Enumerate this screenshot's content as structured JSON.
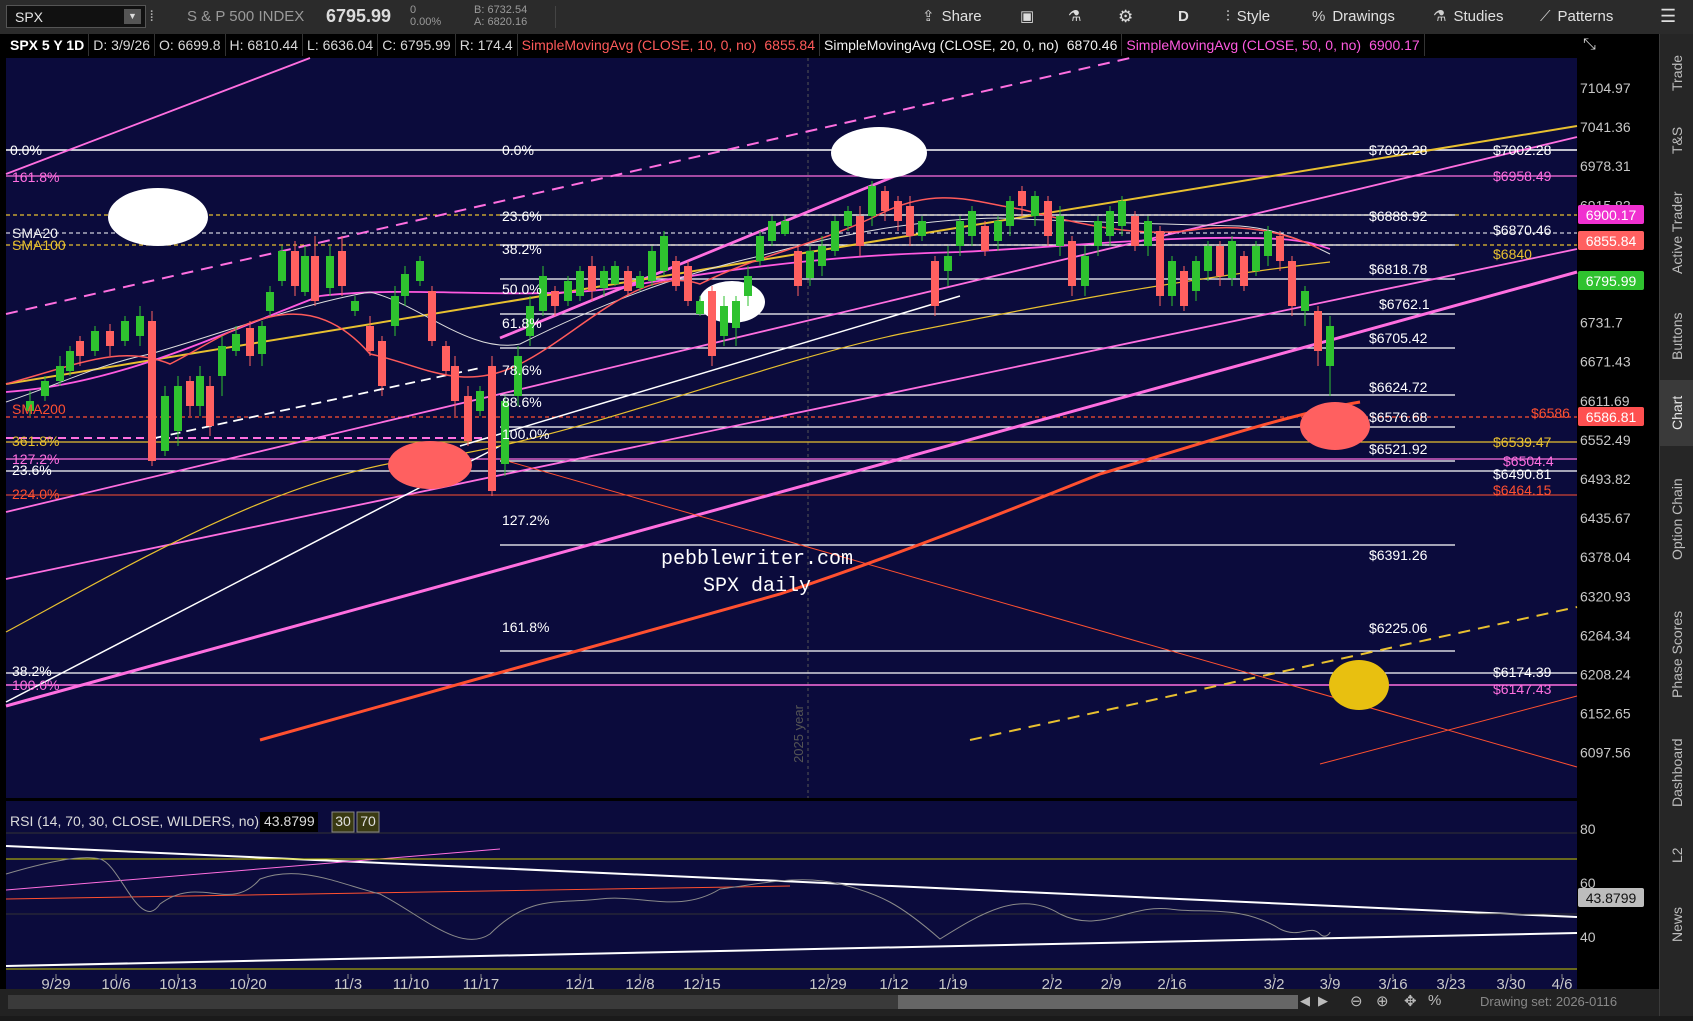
{
  "toolbar": {
    "symbol": "SPX",
    "name": "S & P 500 INDEX",
    "last": "6795.99",
    "change": "0",
    "change_pct": "0.00%",
    "bid": "B: 6732.54",
    "ask": "A: 6820.16",
    "share": "Share",
    "aggregation": "D",
    "style": "Style",
    "drawings": "Drawings",
    "studies": "Studies",
    "patterns": "Patterns"
  },
  "header": {
    "series": "SPX 5 Y 1D",
    "date": "D: 3/9/26",
    "open": "O: 6699.8",
    "high": "H: 6810.44",
    "low": "L: 6636.04",
    "close": "C: 6795.99",
    "range": "R: 174.4",
    "sma10_label": "SimpleMovingAvg (CLOSE, 10, 0, no)",
    "sma10_value": "6855.84",
    "sma20_label": "SimpleMovingAvg (CLOSE, 20, 0, no)",
    "sma20_value": "6870.46",
    "sma50_label": "SimpleMovingAvg (CLOSE, 50, 0, no)",
    "sma50_value": "6900.17"
  },
  "price_axis": [
    "7104.97",
    "7041.36",
    "6978.31",
    "6915.82",
    "6853.41",
    "6792.54",
    "6731.7",
    "6671.43",
    "6611.69",
    "6552.49",
    "6493.82",
    "6435.67",
    "6378.04",
    "6320.93",
    "6264.34",
    "6208.24",
    "6152.65",
    "6097.56"
  ],
  "price_badges": [
    {
      "text": "6900.17",
      "bg": "#f030d0",
      "fg": "#ffffff"
    },
    {
      "text": "6855.84",
      "bg": "#ff6060",
      "fg": "#ffffff"
    },
    {
      "text": "6795.99",
      "bg": "#2fc22f",
      "fg": "#ffffff"
    },
    {
      "text": "6586.81",
      "bg": "#ff5050",
      "fg": "#ffffff"
    },
    {
      "text": "43.8799",
      "bg": "#bdbdbd",
      "fg": "#111111"
    }
  ],
  "x_axis": [
    "9/29",
    "10/6",
    "10/13",
    "10/20",
    "11/3",
    "11/10",
    "11/17",
    "12/1",
    "12/8",
    "12/15",
    "12/29",
    "1/12",
    "1/19",
    "2/2",
    "2/9",
    "2/16",
    "3/2",
    "3/9",
    "3/16",
    "3/23",
    "3/30",
    "4/6"
  ],
  "year_marker": "2025 year",
  "left_fib": [
    {
      "text": "0.0%",
      "color": "#ffffff"
    },
    {
      "text": "161.8%",
      "color": "#ff6fe0"
    },
    {
      "text": "SMA20",
      "color": "#f0f0f0"
    },
    {
      "text": "SMA100",
      "color": "#e8c030"
    },
    {
      "text": "SMA200",
      "color": "#ff5030"
    },
    {
      "text": "361.8%",
      "color": "#e8c030"
    },
    {
      "text": "127.2%",
      "color": "#ff6fe0"
    },
    {
      "text": "23.6%",
      "color": "#ffffff"
    },
    {
      "text": "224.0%",
      "color": "#ff5030"
    },
    {
      "text": "38.2%",
      "color": "#ffffff"
    },
    {
      "text": "100.0%",
      "color": "#ff6fe0"
    }
  ],
  "mid_fib": [
    "0.0%",
    "23.6%",
    "38.2%",
    "50.0%",
    "61.8%",
    "78.6%",
    "88.6%",
    "100.0%",
    "127.2%",
    "161.8%"
  ],
  "right_fib": [
    {
      "text": "$7002.28",
      "color": "#ffffff"
    },
    {
      "text": "$7002.28",
      "color": "#ffffff"
    },
    {
      "text": "$6958.49",
      "color": "#ff6fe0"
    },
    {
      "text": "$6888.92",
      "color": "#ffffff"
    },
    {
      "text": "$6870.46",
      "color": "#ffffff"
    },
    {
      "text": "$6840",
      "color": "#e8c030"
    },
    {
      "text": "$6818.78",
      "color": "#ffffff"
    },
    {
      "text": "$6762.1",
      "color": "#ffffff"
    },
    {
      "text": "$6705.42",
      "color": "#ffffff"
    },
    {
      "text": "$6624.72",
      "color": "#ffffff"
    },
    {
      "text": "$6586",
      "color": "#ff5030"
    },
    {
      "text": "$6576.68",
      "color": "#ffffff"
    },
    {
      "text": "$6539.47",
      "color": "#e8c030"
    },
    {
      "text": "$6521.92",
      "color": "#ffffff"
    },
    {
      "text": "$6504.4",
      "color": "#ff6fe0"
    },
    {
      "text": "$6490.81",
      "color": "#ffffff"
    },
    {
      "text": "$6464.15",
      "color": "#ff5030"
    },
    {
      "text": "$6391.26",
      "color": "#ffffff"
    },
    {
      "text": "$6225.06",
      "color": "#ffffff"
    },
    {
      "text": "$6174.39",
      "color": "#ffffff"
    },
    {
      "text": "$6147.43",
      "color": "#ff6fe0"
    }
  ],
  "watermark": {
    "line1": "pebblewriter.com",
    "line2": "SPX daily"
  },
  "rsi": {
    "label": "RSI (14, 70, 30, CLOSE, WILDERS, no)",
    "value": "43.8799",
    "ob": "30",
    "os": "70",
    "axis": [
      "80",
      "60",
      "40"
    ]
  },
  "sidebar_tabs": [
    "Trade",
    "T&S",
    "Active Trader",
    "Buttons",
    "Chart",
    "Option Chain",
    "Phase Scores",
    "Dashboard",
    "L2",
    "News"
  ],
  "bottom": {
    "drawing_set": "Drawing set: 2026-0116"
  },
  "colors": {
    "bg": "#0b0b3c",
    "up": "#2fc22f",
    "down": "#ff6060",
    "fib": "#ffffff",
    "pink": "#ff6fe0",
    "gold": "#e8c030",
    "sma200": "#ff5030"
  }
}
